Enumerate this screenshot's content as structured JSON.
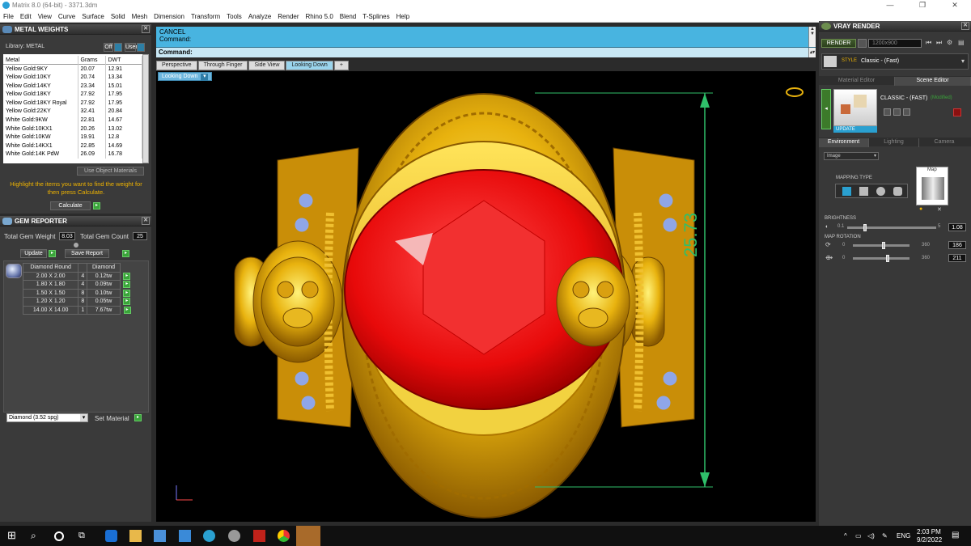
{
  "window": {
    "title": "Matrix 8.0 (64-bit) - 3371.3dm"
  },
  "menu": [
    "File",
    "Edit",
    "View",
    "Curve",
    "Surface",
    "Solid",
    "Mesh",
    "Dimension",
    "Transform",
    "Tools",
    "Analyze",
    "Render",
    "Rhino 5.0",
    "Blend",
    "T-Splines",
    "Help"
  ],
  "metal_weights": {
    "title": "METAL WEIGHTS",
    "library_label": "Library: METAL",
    "toggle1": "Off",
    "toggle2": "User",
    "columns": [
      "Metal",
      "Grams",
      "DWT"
    ],
    "rows": [
      [
        "Yellow Gold:9KY",
        "20.07",
        "12.91"
      ],
      [
        "Yellow Gold:10KY",
        "20.74",
        "13.34"
      ],
      [
        "Yellow Gold:14KY",
        "23.34",
        "15.01"
      ],
      [
        "Yellow Gold:18KY",
        "27.92",
        "17.95"
      ],
      [
        "Yellow Gold:18KY Royal",
        "27.92",
        "17.95"
      ],
      [
        "Yellow Gold:22KY",
        "32.41",
        "20.84"
      ],
      [
        "White Gold:9KW",
        "22.81",
        "14.67"
      ],
      [
        "White Gold:10KX1",
        "20.26",
        "13.02"
      ],
      [
        "White Gold:10KW",
        "19.91",
        "12.8"
      ],
      [
        "White Gold:14KX1",
        "22.85",
        "14.69"
      ],
      [
        "White Gold:14K PdW",
        "26.09",
        "16.78"
      ]
    ],
    "use_object_materials": "Use Object Materials",
    "hint": "Highlight the items you want to find the weight for then press Calculate.",
    "calculate": "Calculate"
  },
  "gem_reporter": {
    "title": "GEM REPORTER",
    "total_weight_label": "Total Gem Weight",
    "total_weight": "8.03",
    "total_count_label": "Total Gem Count",
    "total_count": "25",
    "update": "Update",
    "save_report": "Save Report",
    "columns": [
      "Diamond Round",
      "",
      "Diamond"
    ],
    "rows": [
      [
        "2.00 X 2.00",
        "4",
        "0.12tw"
      ],
      [
        "1.80 X 1.80",
        "4",
        "0.09tw"
      ],
      [
        "1.50 X 1.50",
        "8",
        "0.10tw"
      ],
      [
        "1.20 X 1.20",
        "8",
        "0.05tw"
      ],
      [
        "14.00 X 14.00",
        "1",
        "7.67tw"
      ]
    ],
    "material_select": "Diamond      (3.52 spg)",
    "set_material": "Set Material"
  },
  "command": {
    "line1": "CANCEL",
    "line2": "Command:",
    "prompt": "Command:"
  },
  "view_tabs": [
    "Perspective",
    "Through Finger",
    "Side View",
    "Looking Down",
    "+"
  ],
  "active_view": "Looking Down",
  "viewport_label": "Looking Down",
  "dimension_value": "25.73",
  "vray": {
    "title": "VRAY RENDER",
    "render_button": "RENDER",
    "resolution": "1200x900",
    "style_label": "STYLE",
    "style_value": "Classic - (Fast)",
    "tabs": [
      "Material Editor",
      "Scene Editor"
    ],
    "preset_name": "CLASSIC - (FAST)",
    "preset_status": "(Modified)",
    "update": "UPDATE",
    "env_tabs": [
      "Environment",
      "Lighting",
      "Camera"
    ],
    "env_select": "Image",
    "mapping_type": "MAPPING TYPE",
    "map_label": "Map",
    "brightness": {
      "label": "BRIGHTNESS",
      "min": "0.1",
      "max": "5",
      "value": "1.08"
    },
    "map_rotation": {
      "label": "MAP ROTATION",
      "min": "0",
      "max": "360",
      "value1": "186",
      "value2": "211"
    }
  },
  "taskbar": {
    "lang": "ENG",
    "time": "2:03 PM",
    "date": "9/2/2022"
  },
  "colors": {
    "accent": "#48b4e0",
    "gold": "#f0c020",
    "gem": "#e01010",
    "dimension": "#2fbf6a"
  }
}
